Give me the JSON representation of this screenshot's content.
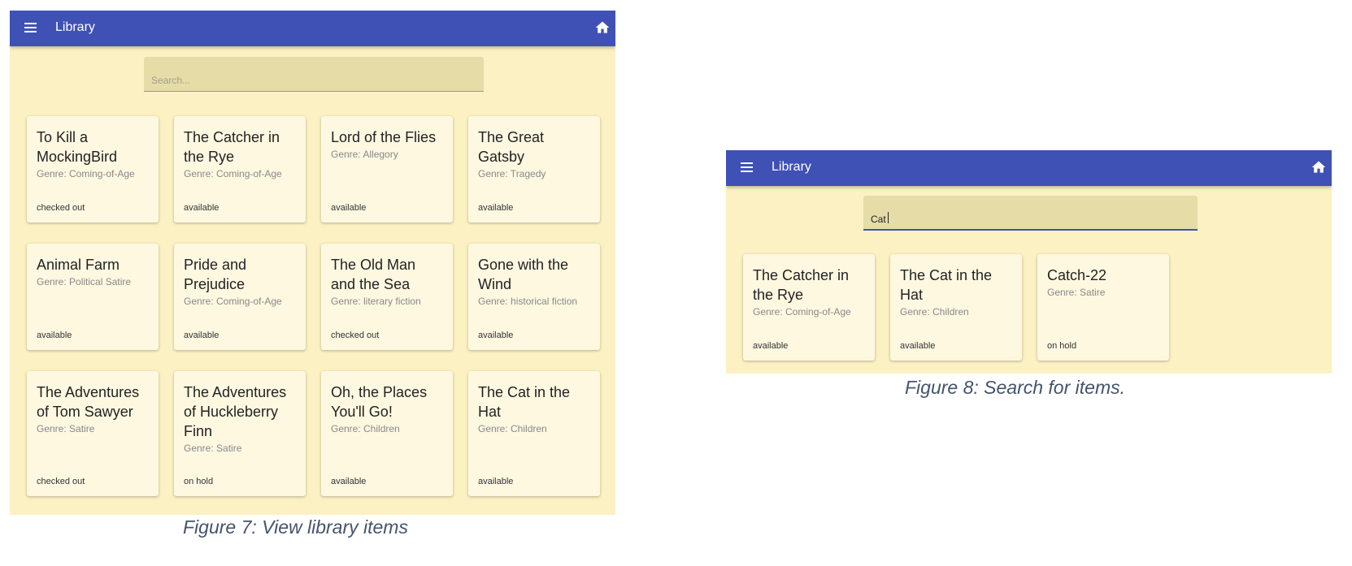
{
  "colors": {
    "appbar": "#3f51b5",
    "background": "#fbf1c2",
    "card": "#fef8e1",
    "search": "#e6dca8",
    "caption": "#44546a"
  },
  "figure7": {
    "app_title": "Library",
    "search_placeholder": "Search...",
    "cards": [
      {
        "title": "To Kill a MockingBird",
        "genre": "Genre: Coming-of-Age",
        "status": "checked out"
      },
      {
        "title": "The Catcher in the Rye",
        "genre": "Genre: Coming-of-Age",
        "status": "available"
      },
      {
        "title": "Lord of the Flies",
        "genre": "Genre: Allegory",
        "status": "available"
      },
      {
        "title": "The Great Gatsby",
        "genre": "Genre: Tragedy",
        "status": "available"
      },
      {
        "title": "Animal Farm",
        "genre": "Genre: Political Satire",
        "status": "available"
      },
      {
        "title": "Pride and Prejudice",
        "genre": "Genre: Coming-of-Age",
        "status": "available"
      },
      {
        "title": "The Old Man and the Sea",
        "genre": "Genre: literary fiction",
        "status": "checked out"
      },
      {
        "title": "Gone with the Wind",
        "genre": "Genre: historical fiction",
        "status": "available"
      },
      {
        "title": "The Adventures of Tom Sawyer",
        "genre": "Genre: Satire",
        "status": "checked out"
      },
      {
        "title": "The Adventures of Huckleberry Finn",
        "genre": "Genre: Satire",
        "status": "on hold"
      },
      {
        "title": "Oh, the Places You'll Go!",
        "genre": "Genre: Children",
        "status": "available"
      },
      {
        "title": "The Cat in the Hat",
        "genre": "Genre: Children",
        "status": "available"
      }
    ],
    "caption": "Figure 7: View library items"
  },
  "figure8": {
    "app_title": "Library",
    "search_value": "Cat",
    "cards": [
      {
        "title": "The Catcher in the Rye",
        "genre": "Genre: Coming-of-Age",
        "status": "available"
      },
      {
        "title": "The Cat in the Hat",
        "genre": "Genre: Children",
        "status": "available"
      },
      {
        "title": "Catch-22",
        "genre": "Genre: Satire",
        "status": "on hold"
      }
    ],
    "caption": "Figure 8: Search for items."
  }
}
